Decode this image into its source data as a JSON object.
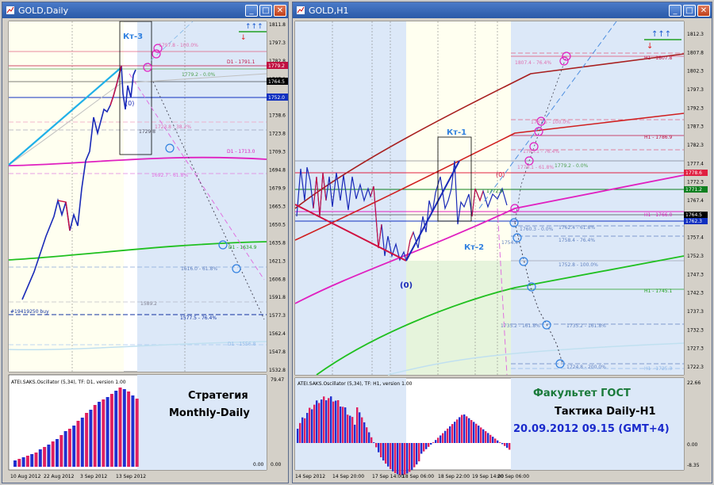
{
  "left": {
    "title": "GOLD,Daily",
    "ticks": [
      "1811.8",
      "1797.3",
      "1782.8",
      "1767.9",
      "1753.4",
      "1738.6",
      "1723.8",
      "1709.3",
      "1694.8",
      "1679.9",
      "1665.3",
      "1650.5",
      "1635.8",
      "1621.3",
      "1606.8",
      "1591.8",
      "1577.3",
      "1562.4",
      "1547.8",
      "1532.8"
    ],
    "osc_ticks": [
      "79.47",
      "0.00"
    ],
    "dates": [
      "10 Aug 2012",
      "22 Aug 2012",
      "3 Sep 2012",
      "13 Sep 2012"
    ],
    "price_boxes": [
      {
        "text": "1779.2",
        "color": "#c01040"
      },
      {
        "text": "1764.5",
        "color": "#000000"
      },
      {
        "text": "1752.0",
        "color": "#1030c0"
      }
    ],
    "labels": {
      "kt3": "Кт-3",
      "zero": "(0)",
      "d1_1791": "D1 - 1791.1",
      "l1779": "1779.2 - 0.0%",
      "l1729": "1729.8",
      "l1723": "1723.8 - 38.2%",
      "d1_1713": "D1 - 1713.0",
      "l1692": "1692.7 - 61.8%",
      "d1_1634": "D1 - 1634.9",
      "l1616": "1616.0 - 61.8%",
      "l1589": "1589.2",
      "order": "#19419250 buy",
      "l1577": "1577.5 - 76.4%",
      "d1_1556": "D1 - 1556.8",
      "l1797": "1797.8 - 100.0%"
    },
    "osc_title": "ATEI.SAKS.Oscillator (5,34), TF: D1, version 1.00",
    "strategy": [
      "Стратегия",
      "Monthly-Daily"
    ],
    "osc_zero": "0.00"
  },
  "right": {
    "title": "GOLD,H1",
    "ticks": [
      "1812.3",
      "1807.8",
      "1802.3",
      "1797.3",
      "1792.3",
      "1787.3",
      "1782.3",
      "1777.4",
      "1772.3",
      "1767.4",
      "1762.3",
      "1757.4",
      "1752.3",
      "1747.3",
      "1742.3",
      "1737.3",
      "1732.3",
      "1727.3",
      "1722.3"
    ],
    "osc_ticks": [
      "22.66",
      "0.00",
      "-8.35"
    ],
    "dates": [
      "14 Sep 2012",
      "14 Sep 20:00",
      "17 Sep 14:00",
      "18 Sep 06:00",
      "18 Sep 22:00",
      "19 Sep 14:00",
      "20 Sep 06:00"
    ],
    "price_boxes": [
      {
        "text": "1778.6",
        "color": "#e02040"
      },
      {
        "text": "1771.2",
        "color": "#108020"
      },
      {
        "text": "1764.5",
        "color": "#000000"
      },
      {
        "text": "1762.3",
        "color": "#1030c0"
      }
    ],
    "labels": {
      "kt1": "Кт-1",
      "kt2": "Кт-2",
      "zero1": "(0)",
      "zero2": "(0)",
      "h1_1807": "H1 - 1807.8",
      "l1807": "1807.4 - 76.4%",
      "l1787": "1787.5 - 100.0%",
      "h1_1786": "H1 - 1786.9",
      "l1783": "1783.1 - 76.4%",
      "l1779a": "1779.1 - 61.8%",
      "l1779b": "1779.2 - 0.0%",
      "l1772": "1772.9",
      "h1_1766": "H1 - 1766.0",
      "l1762": "1762.4 - 61.8%",
      "l1760": "1760.3 - 0.0%",
      "l1758": "1758.4 - 76.4%",
      "l1754": "1754.4",
      "l1752": "1752.8 - 100.0%",
      "h1_1745": "H1 - 1745.1",
      "l1735a": "1735.2 - 161.8%",
      "l1735b": "1735.2 - 161.8%",
      "l1724": "1724.8 - 200.0%",
      "h1_1725": "H1 - 1725.3"
    },
    "osc_title": "ATEI.SAKS.Oscillator (5,34), TF: H1, version 1.00",
    "caption": [
      "Факультет ГОСТ",
      "Тактика Daily-H1",
      "20.09.2012  09.15 (GMT+4)"
    ]
  },
  "colors": {
    "title_green": "#1a7a3a",
    "date_blue": "#1a2acc",
    "chart_bg": "#ffffff",
    "shade": "#dce8f8"
  }
}
